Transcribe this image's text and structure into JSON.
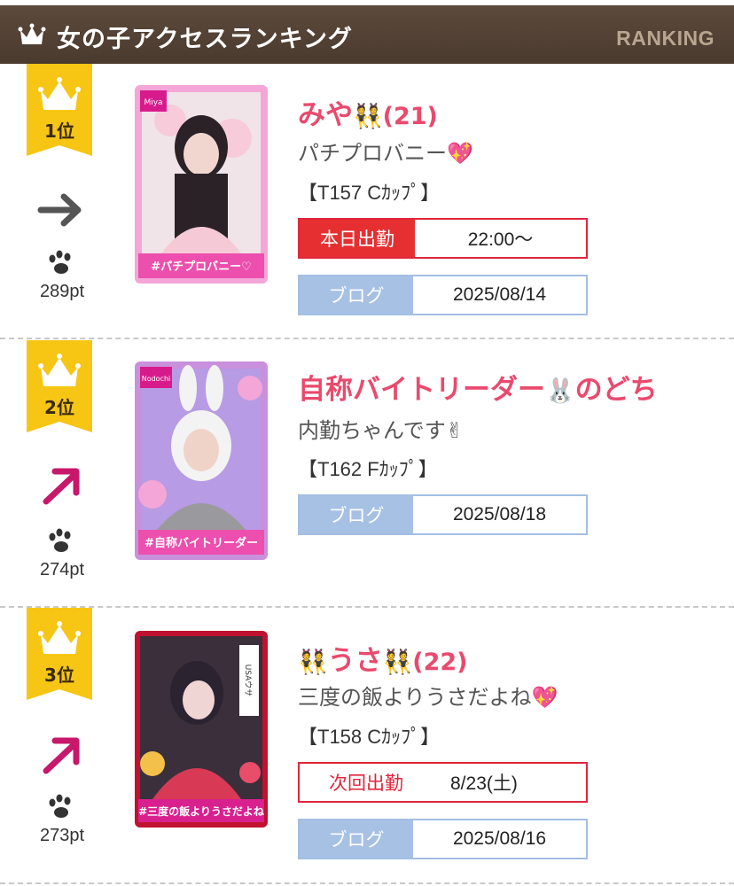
{
  "header": {
    "title": "女の子アクセスランキング",
    "subtitle": "RANKING",
    "icon": "crown-icon"
  },
  "entries": [
    {
      "rank": "1位",
      "trend": "same",
      "trend_icon": "arrow-right-icon",
      "points": "289pt",
      "photo_name_tag": "Miya",
      "photo_caption": "#パチプロバニー♡",
      "name": "みや",
      "name_emoji": "👯",
      "age": "(21)",
      "catchphrase": "パチプロバニー💖",
      "size": "【T157 Cｶｯﾌﾟ】",
      "attendance_label": "本日出勤",
      "attendance_value": "22:00〜",
      "blog_label": "ブログ",
      "blog_date": "2025/08/14"
    },
    {
      "rank": "2位",
      "trend": "up",
      "trend_icon": "arrow-up-right-icon",
      "points": "274pt",
      "photo_name_tag": "Nodochi",
      "photo_caption": "#自称バイトリーダー",
      "name": "自称バイトリーダー",
      "name_emoji": "🐰",
      "name_suffix": "のどち",
      "catchphrase": "内勤ちゃんです✌",
      "size": "【T162 Fｶｯﾌﾟ】",
      "blog_label": "ブログ",
      "blog_date": "2025/08/18"
    },
    {
      "rank": "3位",
      "trend": "up",
      "trend_icon": "arrow-up-right-icon",
      "points": "273pt",
      "photo_name_tag": "USAウサ",
      "photo_caption": "#三度の飯よりうさだよね",
      "name_emoji_pre": "👯",
      "name": "うさ",
      "name_emoji": "👯",
      "age": "(22)",
      "catchphrase": "三度の飯よりうさだよね💖",
      "size": "【T158 Cｶｯﾌﾟ】",
      "attendance_label": "次回出勤",
      "attendance_value": "8/23(土)",
      "blog_label": "ブログ",
      "blog_date": "2025/08/16"
    }
  ],
  "colors": {
    "header_bg": "#4f3e31",
    "accent_pink": "#e94a6d",
    "attend_red": "#e62f31",
    "blog_blue": "#a6c1e4",
    "badge_gold": "#f7c614"
  }
}
